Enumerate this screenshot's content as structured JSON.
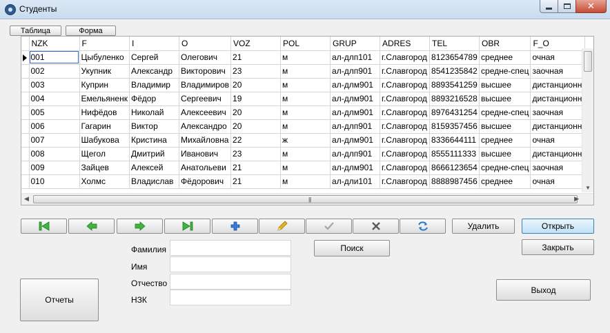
{
  "window": {
    "title": "Студенты"
  },
  "tabs": {
    "table_label": "Таблица",
    "form_label": "Форма"
  },
  "grid": {
    "columns": [
      "NZK",
      "F",
      "I",
      "O",
      "VOZ",
      "POL",
      "GRUP",
      "ADRES",
      "TEL",
      "OBR",
      "F_O"
    ],
    "rows": [
      [
        "001",
        "Цыбуленко",
        "Сергей",
        "Олегович",
        "21",
        "м",
        "ал-длп101",
        "г.Славгород",
        "8123654789",
        "среднее",
        "очная"
      ],
      [
        "002",
        "Укупник",
        "Александр",
        "Викторович",
        "23",
        "м",
        "ал-длп901",
        "г.Славгород",
        "8541235842",
        "средне-спец",
        "заочная"
      ],
      [
        "003",
        "Куприн",
        "Владимир",
        "Владимиров",
        "20",
        "м",
        "ал-длм901",
        "г.Славгород",
        "8893541259",
        "высшее",
        "дистанционн"
      ],
      [
        "004",
        "Емельяненк",
        "Фёдор",
        "Сергеевич",
        "19",
        "м",
        "ал-длм901",
        "г.Славгород",
        "8893216528",
        "высшее",
        "дистанционн"
      ],
      [
        "005",
        "Нифёдов",
        "Николай",
        "Алексеевич",
        "20",
        "м",
        "ал-длм901",
        "г.Славгород",
        "8976431254",
        "средне-спец",
        "заочная"
      ],
      [
        "006",
        "Гагарин",
        "Виктор",
        "Александро",
        "20",
        "м",
        "ал-длп901",
        "г.Славгород",
        "8159357456",
        "высшее",
        "дистанционн"
      ],
      [
        "007",
        "Шабукова",
        "Кристина",
        "Михайловна",
        "22",
        "ж",
        "ал-длм901",
        "г.Славгород",
        "8336644111",
        "среднее",
        "очная"
      ],
      [
        "008",
        "Щегол",
        "Дмитрий",
        "Иванович",
        "23",
        "м",
        "ал-длп901",
        "г.Славгород",
        "8555111333",
        "высшее",
        "дистанционн"
      ],
      [
        "009",
        "Зайцев",
        "Алексей",
        "Анатольеви",
        "21",
        "м",
        "ал-длм901",
        "г.Славгород",
        "8666123654",
        "средне-спец",
        "заочная"
      ],
      [
        "010",
        "Холмс",
        "Владислав",
        "Фёдорович",
        "21",
        "м",
        "ал-дли101",
        "г.Славгород",
        "8888987456",
        "среднее",
        "очная"
      ]
    ]
  },
  "navigator": {
    "icons": [
      "first-record-icon",
      "prior-record-icon",
      "next-record-icon",
      "last-record-icon",
      "insert-record-icon",
      "edit-record-icon",
      "post-record-icon",
      "cancel-record-icon",
      "refresh-records-icon"
    ],
    "colors": {
      "arrow_green": "#3fb53f",
      "plus_blue": "#3a78d6",
      "pencil_yellow": "#e6b422",
      "refresh_blue": "#2a79c9"
    }
  },
  "buttons": {
    "delete": "Удалить",
    "open": "Открыть",
    "close": "Закрыть",
    "search": "Поиск",
    "reports": "Отчеты",
    "exit": "Выход"
  },
  "search_form": {
    "surname_label": "Фамилия",
    "name_label": "Имя",
    "patronymic_label": "Отчество",
    "nzk_label": "НЗК",
    "surname_value": "",
    "name_value": "",
    "patronymic_value": "",
    "nzk_value": ""
  }
}
